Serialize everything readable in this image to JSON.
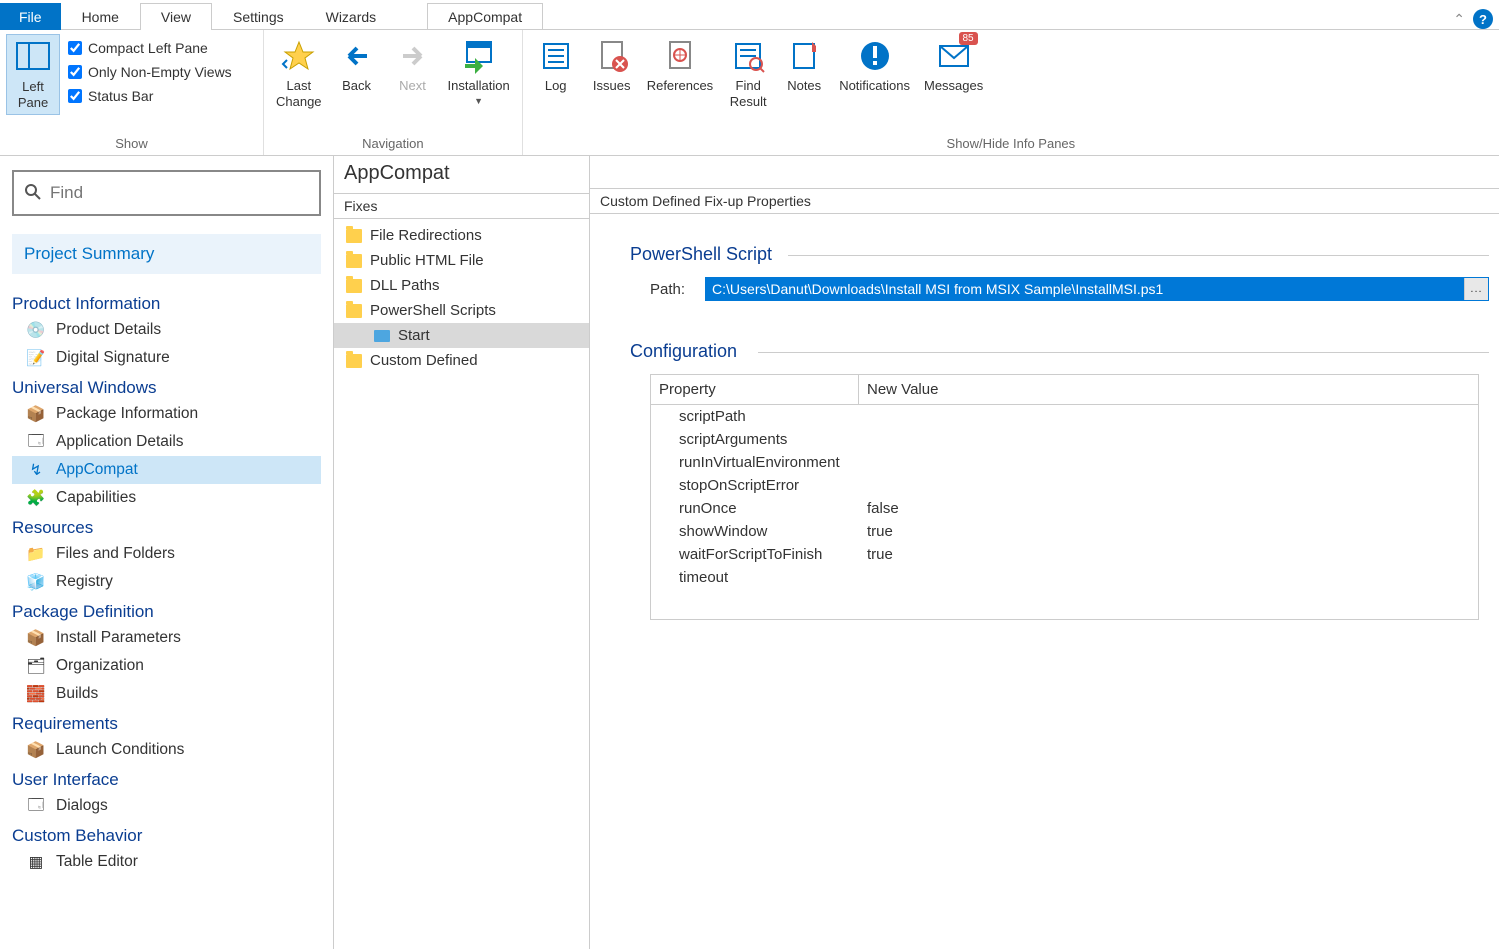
{
  "tabs": {
    "file": "File",
    "home": "Home",
    "view": "View",
    "settings": "Settings",
    "wizards": "Wizards",
    "context": "AppCompat"
  },
  "ribbon": {
    "show": {
      "leftpane": "Left\nPane",
      "compact": "Compact Left Pane",
      "nonempty": "Only Non-Empty Views",
      "statusbar": "Status Bar",
      "group": "Show"
    },
    "nav": {
      "lastchange": "Last\nChange",
      "back": "Back",
      "next": "Next",
      "installation": "Installation",
      "group": "Navigation"
    },
    "panes": {
      "log": "Log",
      "issues": "Issues",
      "references": "References",
      "findresult": "Find\nResult",
      "notes": "Notes",
      "notifications": "Notifications",
      "messages": "Messages",
      "badge": "85",
      "group": "Show/Hide Info Panes"
    }
  },
  "search": {
    "placeholder": "Find"
  },
  "summary": "Project Summary",
  "nav": {
    "s1": "Product Information",
    "s1_1": "Product Details",
    "s1_2": "Digital Signature",
    "s2": "Universal Windows",
    "s2_1": "Package Information",
    "s2_2": "Application Details",
    "s2_3": "AppCompat",
    "s2_4": "Capabilities",
    "s3": "Resources",
    "s3_1": "Files and Folders",
    "s3_2": "Registry",
    "s4": "Package Definition",
    "s4_1": "Install Parameters",
    "s4_2": "Organization",
    "s4_3": "Builds",
    "s5": "Requirements",
    "s5_1": "Launch Conditions",
    "s6": "User Interface",
    "s6_1": "Dialogs",
    "s7": "Custom Behavior",
    "s7_1": "Table Editor"
  },
  "mid": {
    "title": "AppCompat",
    "header": "Fixes",
    "items": {
      "i1": "File Redirections",
      "i2": "Public HTML File",
      "i3": "DLL Paths",
      "i4": "PowerShell Scripts",
      "i4_1": "Start",
      "i5": "Custom Defined"
    }
  },
  "right": {
    "header": "Custom Defined Fix-up Properties",
    "section1": "PowerShell Script",
    "pathlabel": "Path:",
    "pathvalue": "C:\\Users\\Danut\\Downloads\\Install MSI from MSIX Sample\\InstallMSI.ps1",
    "section2": "Configuration",
    "colprop": "Property",
    "colval": "New Value",
    "rows": [
      {
        "p": "scriptPath",
        "v": ""
      },
      {
        "p": "scriptArguments",
        "v": ""
      },
      {
        "p": "runInVirtualEnvironment",
        "v": ""
      },
      {
        "p": "stopOnScriptError",
        "v": ""
      },
      {
        "p": "runOnce",
        "v": "false"
      },
      {
        "p": "showWindow",
        "v": "true"
      },
      {
        "p": "waitForScriptToFinish",
        "v": "true"
      },
      {
        "p": "timeout",
        "v": ""
      }
    ]
  }
}
